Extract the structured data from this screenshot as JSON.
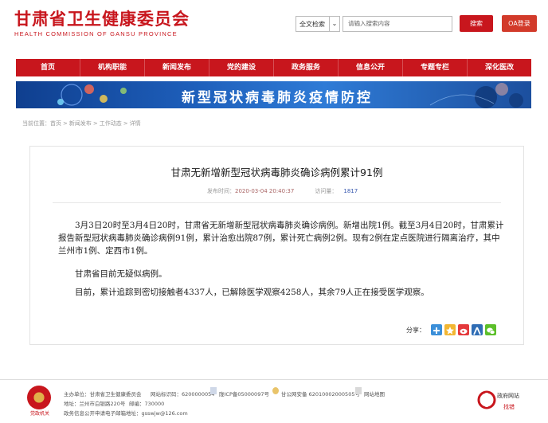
{
  "header": {
    "logo_cn": "甘肃省卫生健康委员会",
    "logo_en": "HEALTH COMMISSION OF GANSU PROVINCE",
    "search_scope": "全文检索",
    "search_placeholder": "请输入搜索内容",
    "search_button": "搜索",
    "oa_button": "OA登录"
  },
  "nav": [
    "首页",
    "机构职能",
    "新闻发布",
    "党的建设",
    "政务服务",
    "信息公开",
    "专题专栏",
    "深化医改"
  ],
  "banner": {
    "title": "新型冠状病毒肺炎疫情防控"
  },
  "breadcrumb": {
    "prefix": "当前位置：",
    "items": [
      "首页",
      "新闻发布",
      "工作动态",
      "详情"
    ]
  },
  "article": {
    "title": "甘肃无新增新型冠状病毒肺炎确诊病例累计91例",
    "published_label": "发布时间：",
    "published": "2020-03-04 20:40:37",
    "visits_label": "访问量：",
    "visits": "1817",
    "paragraphs": [
      "3月3日20时至3月4日20时，甘肃省无新增新型冠状病毒肺炎确诊病例。新增出院1例。截至3月4日20时，甘肃累计报告新型冠状病毒肺炎确诊病例91例，累计治愈出院87例，累计死亡病例2例。现有2例在定点医院进行隔离治疗，其中兰州市1例、定西市1例。",
      "甘肃省目前无疑似病例。",
      "目前，累计追踪到密切接触者4337人，已解除医学观察4258人，其余79人正在接受医学观察。"
    ],
    "share_label": "分享："
  },
  "footer": {
    "emblem_text": "党政机关",
    "host": "主办单位：甘肃省卫生健康委员会",
    "site_code": "网站标识码：6200000054",
    "icp": "陇ICP备05000097号",
    "police": "甘公网安备 62010002000505号",
    "sitemap": "网站地图",
    "address": "地址：兰州市白银路220号",
    "postcode": "邮编：730000",
    "email": "政务信息公开申请电子邮箱地址：gsswjw@126.com",
    "gov_label": "政府网站",
    "gov_sub": "找错"
  }
}
